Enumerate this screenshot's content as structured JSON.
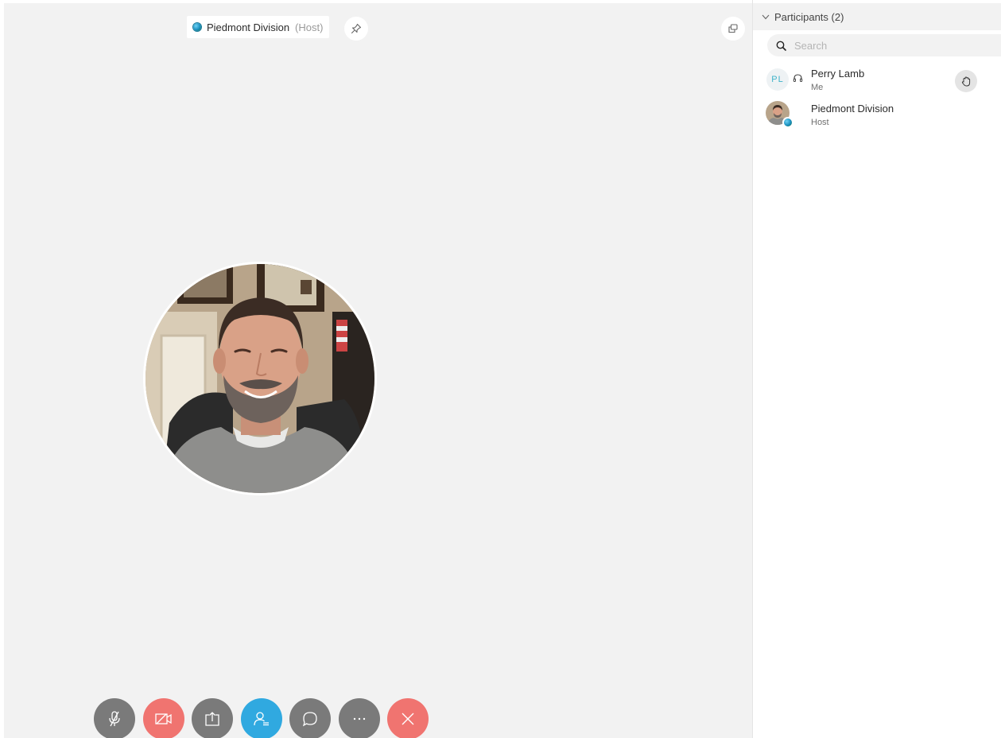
{
  "stage": {
    "active_speaker_name": "Piedmont Division",
    "active_speaker_role": "(Host)",
    "pin_icon": "pin-icon",
    "popout_icon": "popout-window-icon"
  },
  "controls": [
    {
      "name": "mute-button",
      "icon": "microphone-muted-icon",
      "color": "#7a7a7a"
    },
    {
      "name": "video-button",
      "icon": "video-off-icon",
      "color": "#f07470"
    },
    {
      "name": "share-button",
      "icon": "share-screen-icon",
      "color": "#7a7a7a"
    },
    {
      "name": "participants-button",
      "icon": "participants-icon",
      "color": "#30a9e0"
    },
    {
      "name": "chat-button",
      "icon": "chat-bubble-icon",
      "color": "#7a7a7a"
    },
    {
      "name": "more-button",
      "icon": "more-options-icon",
      "color": "#7a7a7a"
    },
    {
      "name": "leave-button",
      "icon": "close-x-icon",
      "color": "#f07470"
    }
  ],
  "sidebar": {
    "header_label": "Participants (2)",
    "search_placeholder": "Search",
    "participants": [
      {
        "initials": "PL",
        "name": "Perry Lamb",
        "subtitle": "Me",
        "audio_icon": "headset-icon",
        "action_icon": "raise-hand-icon"
      },
      {
        "name": "Piedmont Division",
        "subtitle": "Host"
      }
    ]
  },
  "colors": {
    "stage_background": "#f2f2f2",
    "accent_blue": "#30a9e0",
    "danger_red": "#f07470",
    "control_gray": "#7a7a7a",
    "initials_teal": "#3fb3c9"
  }
}
